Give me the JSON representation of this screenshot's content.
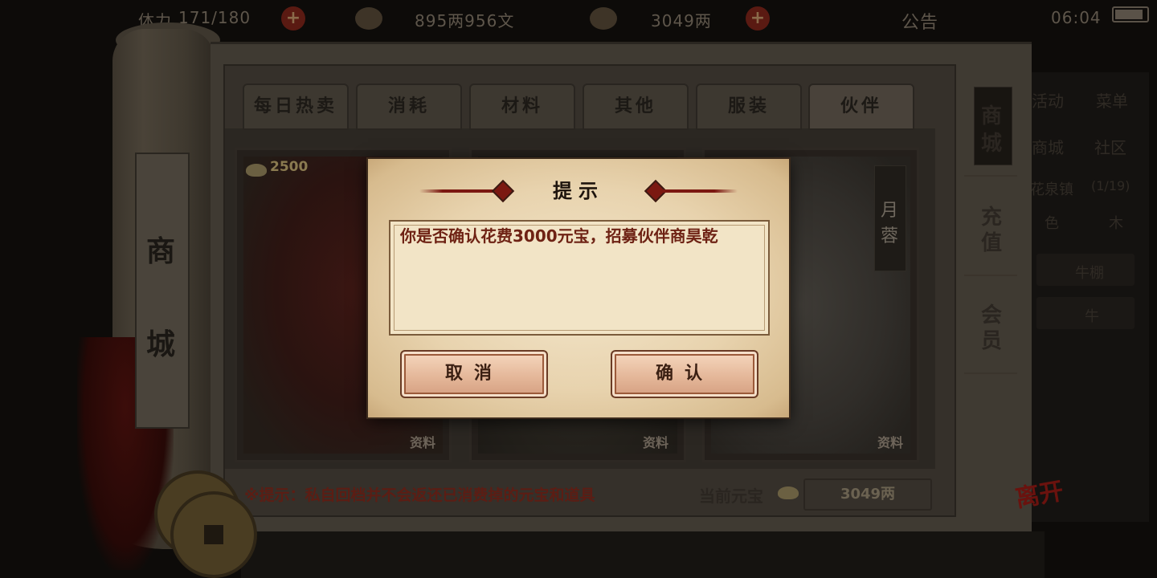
{
  "topbar": {
    "stamina_label": "体力",
    "stamina": "171/180",
    "money": "895两956文",
    "yuanbao": "3049两",
    "notice": "公告",
    "time": "06:04",
    "battery_level": 0.8
  },
  "side_dim": {
    "row1": [
      "活动",
      "菜单"
    ],
    "row2": [
      "商城",
      "社区"
    ],
    "location": "花泉镇",
    "loc_count": "(1/19)",
    "r3": [
      "色",
      "木"
    ],
    "slot1": "牛棚",
    "slot2": "牛"
  },
  "scroll": {
    "title_chars": [
      "商",
      "城"
    ]
  },
  "tabs": [
    "每日热卖",
    "消耗",
    "材料",
    "其他",
    "服装",
    "伙伴"
  ],
  "active_tab": "伙伴",
  "cards": [
    {
      "price": "2500",
      "info": "资料"
    },
    {
      "price": "",
      "info": "资料"
    },
    {
      "price": "",
      "info": "资料",
      "name_chars": [
        "月",
        "蓉"
      ]
    }
  ],
  "side_nav": [
    {
      "chars": [
        "商",
        "城"
      ],
      "active": true
    },
    {
      "chars": [
        "充",
        "值"
      ],
      "active": false
    },
    {
      "chars": [
        "会",
        "员"
      ],
      "active": false
    }
  ],
  "footer": {
    "hint": "※提示：私自回档并不会返还已消费掉的元宝和道具",
    "current_label": "当前元宝",
    "current_value": "3049两"
  },
  "logo": "离开",
  "dialog": {
    "title": "提示",
    "message": "你是否确认花费3000元宝，招募伙伴商昊乾",
    "cancel": "取消",
    "confirm": "确认"
  },
  "colors": {
    "dialog_text": "#6e2214",
    "ornament": "#7b1811",
    "button_fill": "#e3b597"
  }
}
